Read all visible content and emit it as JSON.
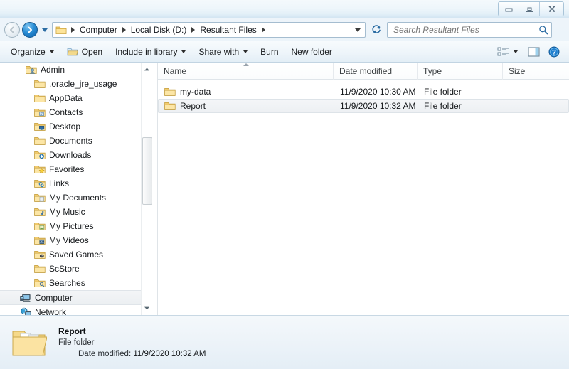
{
  "window": {
    "controls": [
      {
        "name": "minimize",
        "label": "Minimize"
      },
      {
        "name": "restore",
        "label": "Restore Down"
      },
      {
        "name": "close",
        "label": "Close"
      }
    ]
  },
  "address": {
    "back_label": "Back",
    "forward_label": "Forward",
    "history_label": "Recent pages",
    "folder_icon": "folder-icon",
    "breadcrumb": [
      "Computer",
      "Local Disk (D:)",
      "Resultant Files"
    ],
    "dropdown_label": "Previous locations",
    "refresh_label": "Refresh"
  },
  "search": {
    "placeholder": "Search Resultant Files",
    "value": "",
    "icon": "search-icon"
  },
  "toolbar": {
    "organize_label": "Organize",
    "open_label": "Open",
    "include_label": "Include in library",
    "share_label": "Share with",
    "burn_label": "Burn",
    "new_folder_label": "New folder",
    "views_label": "Change your view",
    "preview_label": "Show the preview pane",
    "help_label": "Get help"
  },
  "navpane": {
    "items": [
      {
        "label": "Admin",
        "icon": "user-folder-icon",
        "level": "root",
        "selected": false
      },
      {
        "label": ".oracle_jre_usage",
        "icon": "folder-icon",
        "level": "child",
        "selected": false
      },
      {
        "label": "AppData",
        "icon": "folder-icon",
        "level": "child",
        "selected": false
      },
      {
        "label": "Contacts",
        "icon": "contacts-folder-icon",
        "level": "child",
        "selected": false
      },
      {
        "label": "Desktop",
        "icon": "desktop-folder-icon",
        "level": "child",
        "selected": false
      },
      {
        "label": "Documents",
        "icon": "folder-icon",
        "level": "child",
        "selected": false
      },
      {
        "label": "Downloads",
        "icon": "downloads-folder-icon",
        "level": "child",
        "selected": false
      },
      {
        "label": "Favorites",
        "icon": "favorites-folder-icon",
        "level": "child",
        "selected": false
      },
      {
        "label": "Links",
        "icon": "links-folder-icon",
        "level": "child",
        "selected": false
      },
      {
        "label": "My Documents",
        "icon": "documents-folder-icon",
        "level": "child",
        "selected": false
      },
      {
        "label": "My Music",
        "icon": "music-folder-icon",
        "level": "child",
        "selected": false
      },
      {
        "label": "My Pictures",
        "icon": "pictures-folder-icon",
        "level": "child",
        "selected": false
      },
      {
        "label": "My Videos",
        "icon": "videos-folder-icon",
        "level": "child",
        "selected": false
      },
      {
        "label": "Saved Games",
        "icon": "saved-games-folder-icon",
        "level": "child",
        "selected": false
      },
      {
        "label": "ScStore",
        "icon": "folder-icon",
        "level": "child",
        "selected": false
      },
      {
        "label": "Searches",
        "icon": "searches-folder-icon",
        "level": "child",
        "selected": false
      },
      {
        "label": "Computer",
        "icon": "computer-icon",
        "level": "root-flat",
        "selected": true
      },
      {
        "label": "Network",
        "icon": "network-icon",
        "level": "root-flat",
        "selected": false
      }
    ],
    "scrollbar": {
      "up_label": "Scroll up",
      "down_label": "Scroll down"
    }
  },
  "filelist": {
    "columns": [
      "Name",
      "Date modified",
      "Type",
      "Size"
    ],
    "sort_column": "Name",
    "sort_direction": "ascending",
    "rows": [
      {
        "name": "my-data",
        "date": "11/9/2020 10:30 AM",
        "type": "File folder",
        "size": "",
        "selected": false,
        "icon": "folder-icon"
      },
      {
        "name": "Report",
        "date": "11/9/2020 10:32 AM",
        "type": "File folder",
        "size": "",
        "selected": true,
        "icon": "folder-icon"
      }
    ]
  },
  "details": {
    "icon": "large-folder-icon",
    "title": "Report",
    "type": "File folder",
    "meta_label": "Date modified:",
    "meta_value": "11/9/2020 10:32 AM"
  },
  "colors": {
    "folder_yellow": "#ffd97a",
    "accent_blue": "#1f7fd0",
    "selection_gray": "#eef1f4"
  }
}
